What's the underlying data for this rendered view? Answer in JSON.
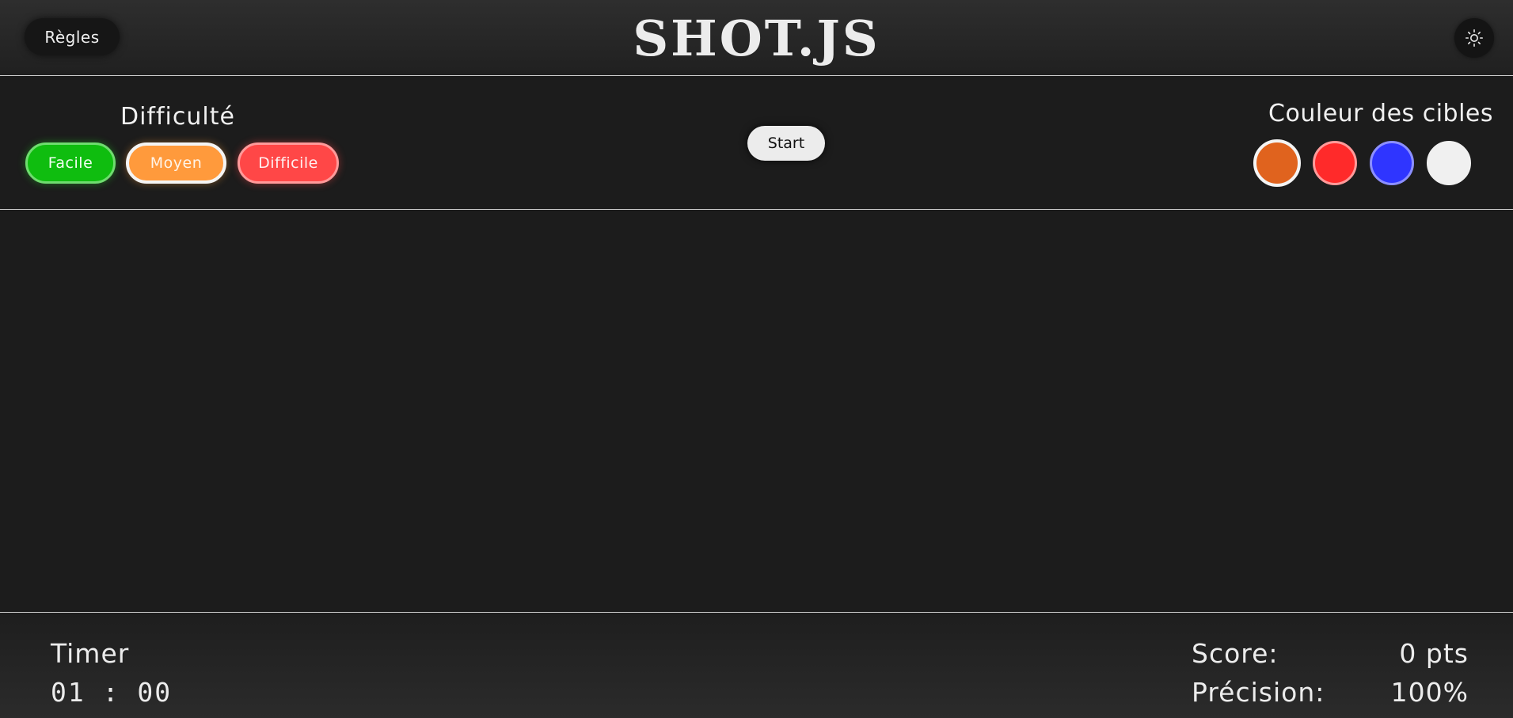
{
  "header": {
    "rules_label": "Règles",
    "title": "SHOT.JS",
    "theme_icon": "sun-icon"
  },
  "settings": {
    "difficulty_title": "Difficulté",
    "difficulties": [
      {
        "label": "Facile",
        "color": "#0fbd0f"
      },
      {
        "label": "Moyen",
        "color": "#ff9a3c",
        "selected": true
      },
      {
        "label": "Difficile",
        "color": "#ff4747"
      }
    ],
    "start_label": "Start",
    "color_title": "Couleur des cibles",
    "target_colors": [
      {
        "name": "orange",
        "hex": "#e0631e",
        "selected": true
      },
      {
        "name": "red",
        "hex": "#ff2a2a"
      },
      {
        "name": "blue",
        "hex": "#2f35ff"
      },
      {
        "name": "white",
        "hex": "#f0f0f0"
      }
    ]
  },
  "stats": {
    "timer_label": "Timer",
    "timer_value": "01 : 00",
    "score_label": "Score:",
    "score_value": "0 pts",
    "precision_label": "Précision:",
    "precision_value": "100%"
  },
  "theme": {
    "background": "#1c1c1c",
    "text": "#ececec"
  }
}
